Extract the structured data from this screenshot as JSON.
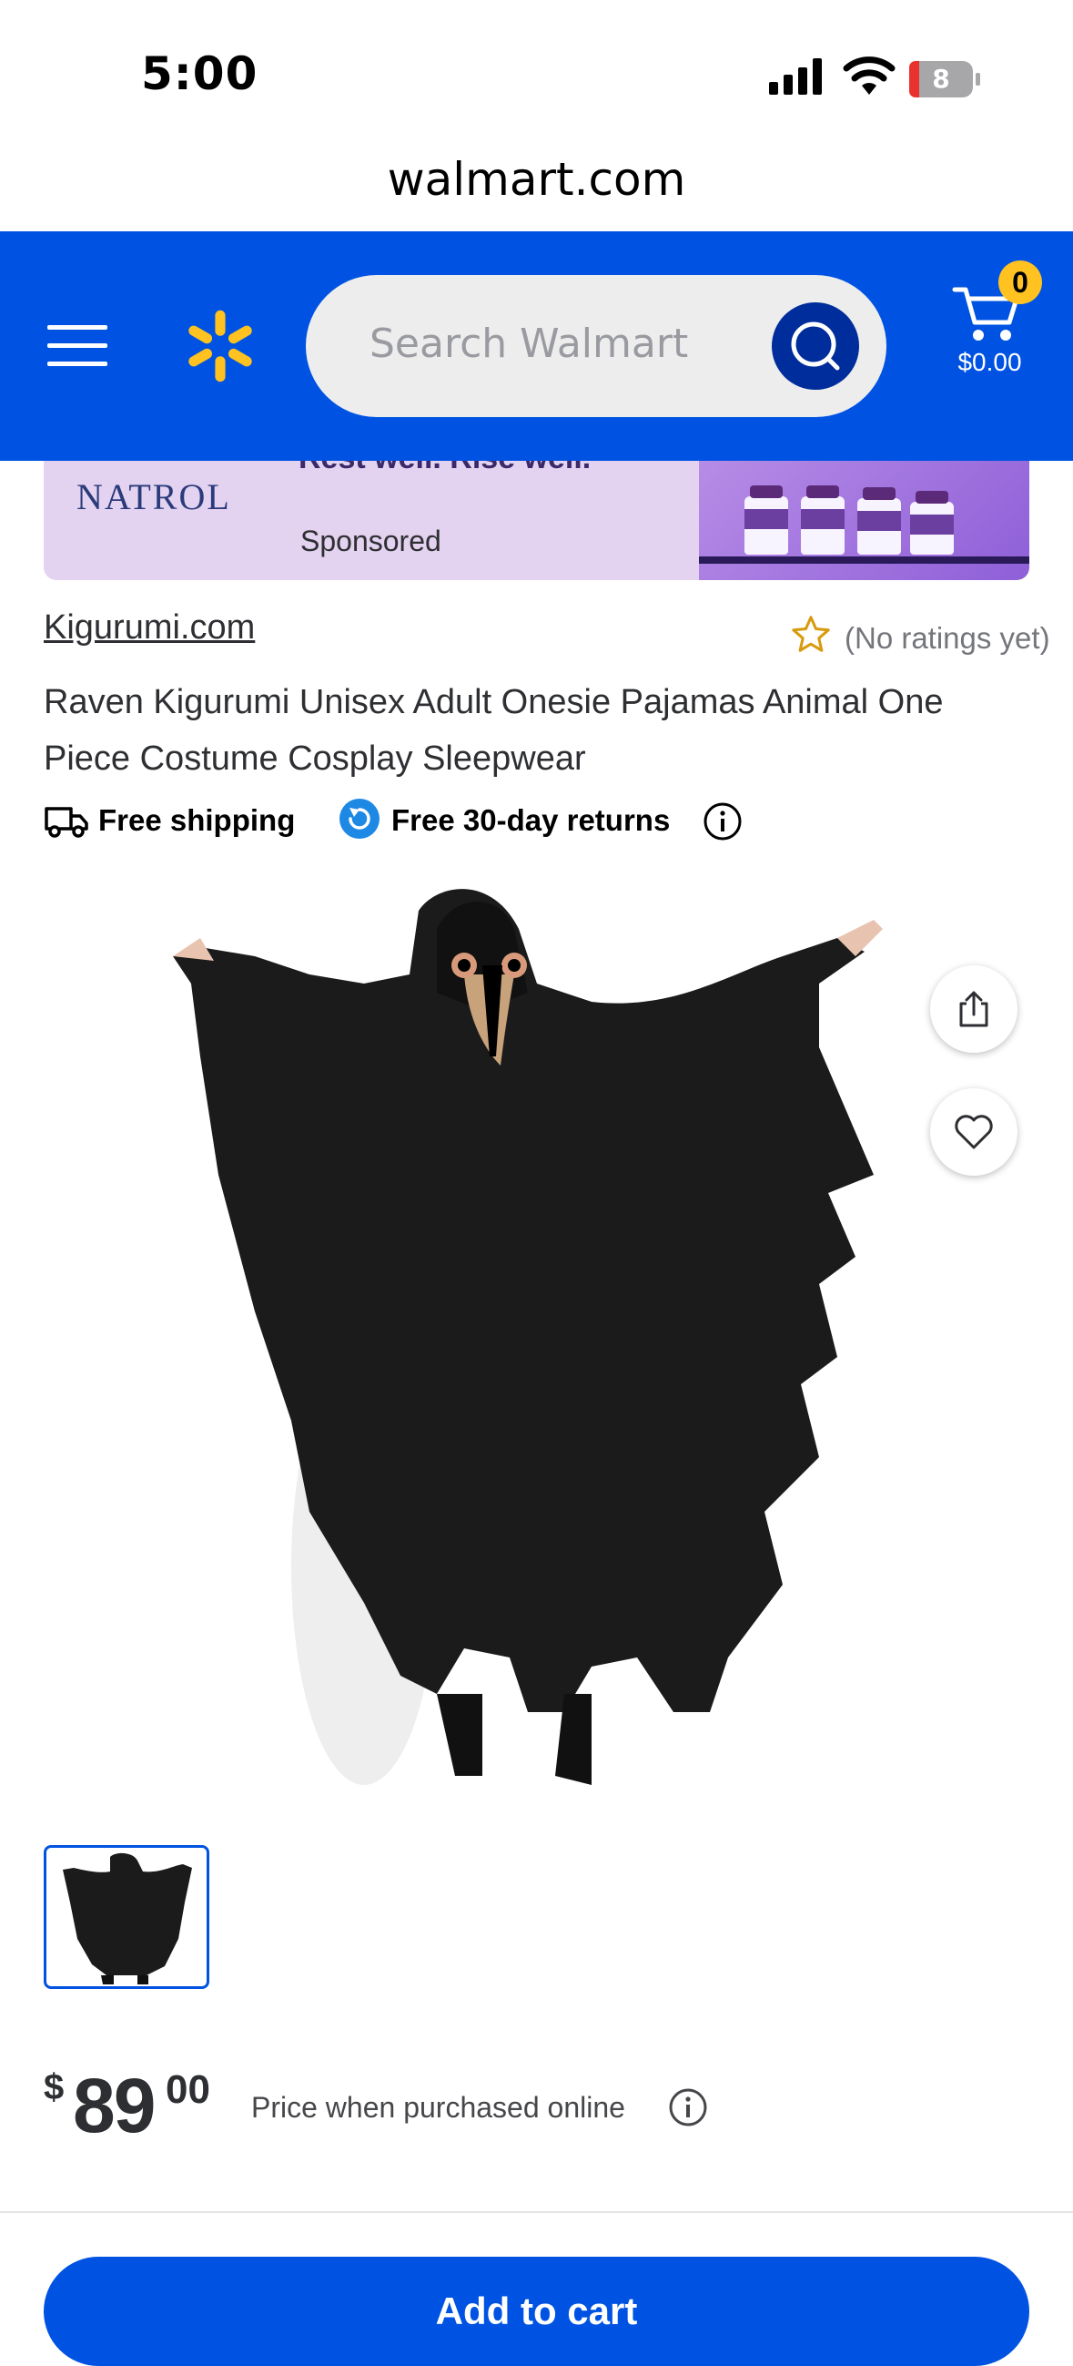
{
  "status_bar": {
    "time": "5:00",
    "battery_level": "8"
  },
  "browser": {
    "url": "walmart.com"
  },
  "header": {
    "search_placeholder": "Search Walmart",
    "cart_count": "0",
    "cart_total": "$0.00",
    "brand_color": "#0053e2",
    "accent_color": "#ffc220"
  },
  "ad": {
    "brand": "NATROL",
    "tagline": "Rest well. Rise well.",
    "sponsored_label": "Sponsored"
  },
  "product": {
    "seller": "Kigurumi.com",
    "rating_text": "(No ratings yet)",
    "title": "Raven Kigurumi Unisex Adult Onesie Pajamas Animal One Piece Costume Cosplay Sleepwear",
    "shipping_label": "Free shipping",
    "returns_label": "Free 30-day returns"
  },
  "price": {
    "currency": "$",
    "dollars": "89",
    "cents": "00",
    "note": "Price when purchased online"
  },
  "actions": {
    "add_to_cart": "Add to cart"
  }
}
